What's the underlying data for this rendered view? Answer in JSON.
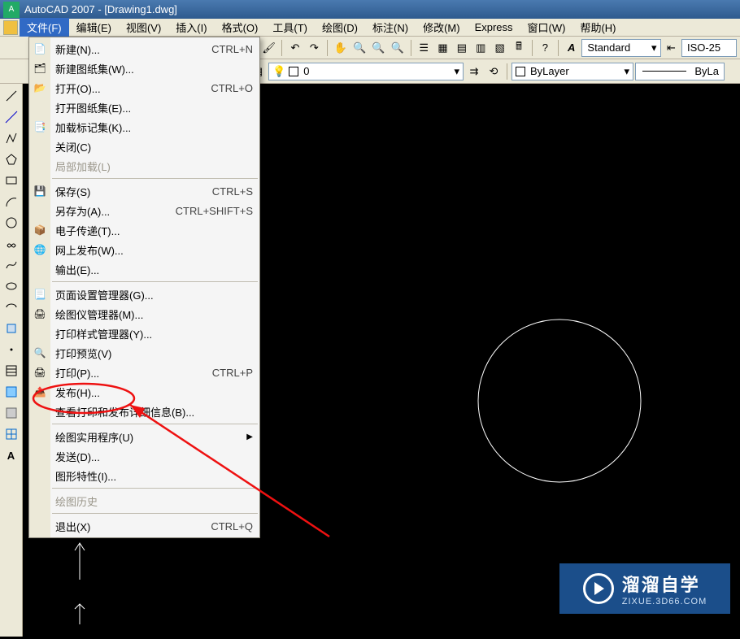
{
  "titlebar": {
    "app": "AutoCAD 2007",
    "doc": "[Drawing1.dwg]"
  },
  "menubar": {
    "items": [
      {
        "label": "文件(F)",
        "active": true
      },
      {
        "label": "编辑(E)"
      },
      {
        "label": "视图(V)"
      },
      {
        "label": "插入(I)"
      },
      {
        "label": "格式(O)"
      },
      {
        "label": "工具(T)"
      },
      {
        "label": "绘图(D)"
      },
      {
        "label": "标注(N)"
      },
      {
        "label": "修改(M)"
      },
      {
        "label": "Express"
      },
      {
        "label": "窗口(W)"
      },
      {
        "label": "帮助(H)"
      }
    ]
  },
  "toolbar2": {
    "layer_combo": "0",
    "style_label": "Standard",
    "dim_label": "ISO-25",
    "bylayer_label": "ByLayer",
    "byla_label": "ByLa"
  },
  "file_menu": {
    "groups": [
      [
        {
          "icon": "new-icon",
          "label": "新建(N)...",
          "shortcut": "CTRL+N"
        },
        {
          "icon": "sheetset-new-icon",
          "label": "新建图纸集(W)..."
        },
        {
          "icon": "open-icon",
          "label": "打开(O)...",
          "shortcut": "CTRL+O"
        },
        {
          "icon": "",
          "label": "打开图纸集(E)..."
        },
        {
          "icon": "markup-icon",
          "label": "加载标记集(K)..."
        },
        {
          "icon": "",
          "label": "关闭(C)"
        },
        {
          "icon": "",
          "label": "局部加载(L)",
          "disabled": true
        }
      ],
      [
        {
          "icon": "save-icon",
          "label": "保存(S)",
          "shortcut": "CTRL+S"
        },
        {
          "icon": "",
          "label": "另存为(A)...",
          "shortcut": "CTRL+SHIFT+S"
        },
        {
          "icon": "etransmit-icon",
          "label": "电子传递(T)..."
        },
        {
          "icon": "publishweb-icon",
          "label": "网上发布(W)..."
        },
        {
          "icon": "",
          "label": "输出(E)..."
        }
      ],
      [
        {
          "icon": "pagesetup-icon",
          "label": "页面设置管理器(G)..."
        },
        {
          "icon": "plotter-icon",
          "label": "绘图仪管理器(M)..."
        },
        {
          "icon": "",
          "label": "打印样式管理器(Y)..."
        },
        {
          "icon": "printpreview-icon",
          "label": "打印预览(V)"
        },
        {
          "icon": "print-icon",
          "label": "打印(P)...",
          "shortcut": "CTRL+P",
          "highlight": true
        },
        {
          "icon": "publish-icon",
          "label": "发布(H)..."
        },
        {
          "icon": "",
          "label": "查看打印和发布详细信息(B)..."
        }
      ],
      [
        {
          "icon": "",
          "label": "绘图实用程序(U)",
          "submenu": true
        },
        {
          "icon": "",
          "label": "发送(D)..."
        },
        {
          "icon": "",
          "label": "图形特性(I)..."
        }
      ],
      [
        {
          "icon": "",
          "label": "绘图历史",
          "disabled": true
        }
      ],
      [
        {
          "icon": "",
          "label": "退出(X)",
          "shortcut": "CTRL+Q"
        }
      ]
    ]
  },
  "left_tools": [
    "line-icon",
    "xline-icon",
    "polyline-icon",
    "polygon-icon",
    "rectangle-icon",
    "arc-icon",
    "circle-icon",
    "revcloud-icon",
    "spline-icon",
    "ellipse-icon",
    "ellipsearc-icon",
    "block-icon",
    "point-icon",
    "hatch-icon",
    "gradient-icon",
    "region-icon",
    "table-icon",
    "text-icon"
  ],
  "watermark": {
    "main": "溜溜自学",
    "sub": "ZIXUE.3D66.COM"
  }
}
